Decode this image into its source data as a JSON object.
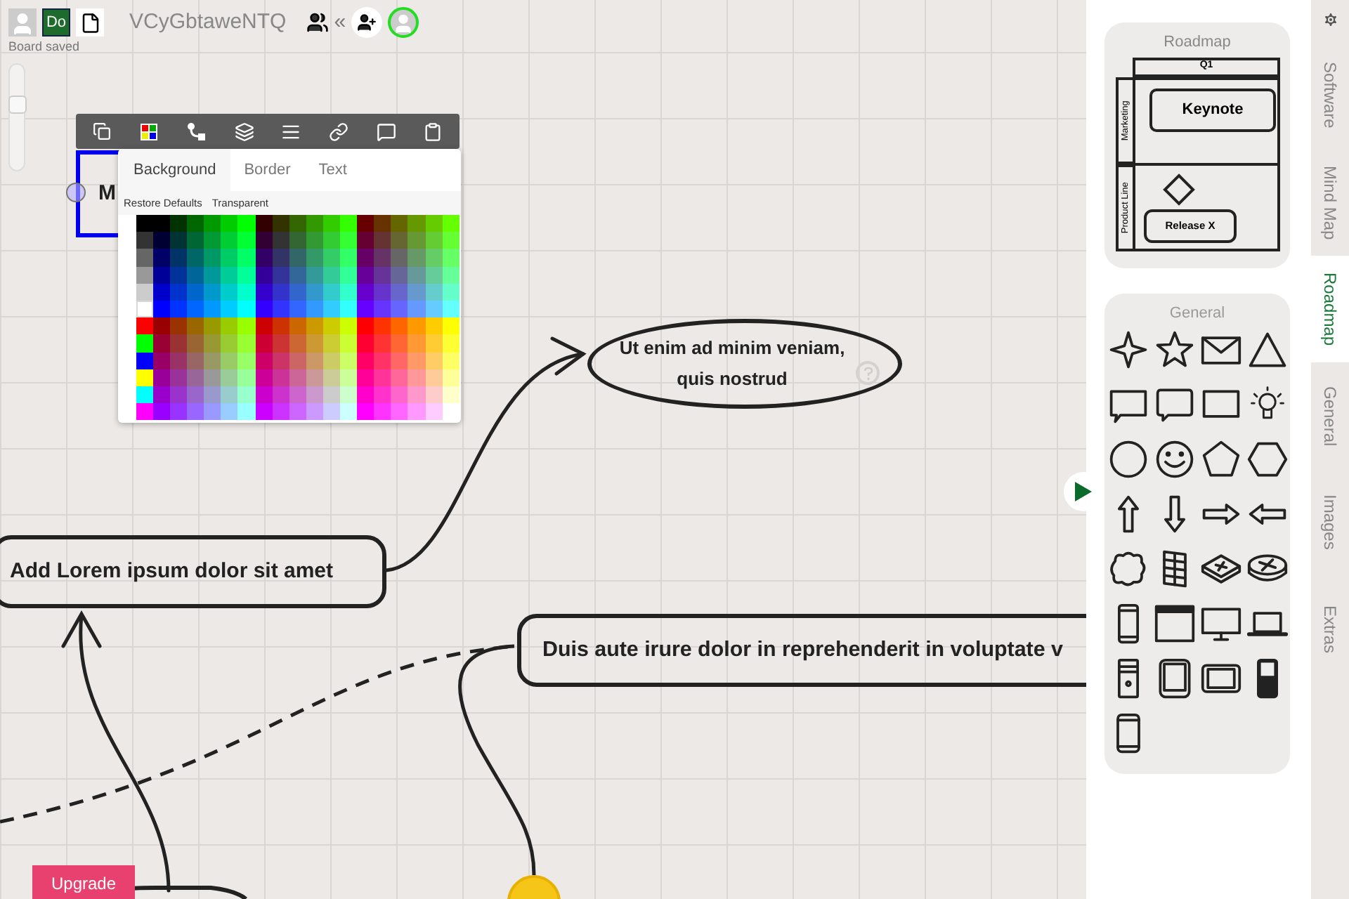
{
  "header": {
    "board_initials": "Do",
    "title": "VCyGbtaweNTQ",
    "collapse_glyph": "«",
    "status": "Board saved"
  },
  "zoom": {
    "level": 0.65
  },
  "color_popover": {
    "tabs": [
      {
        "label": "Background",
        "selected": true
      },
      {
        "label": "Border",
        "selected": false
      },
      {
        "label": "Text",
        "selected": false
      }
    ],
    "actions": [
      "Restore Defaults",
      "Transparent"
    ]
  },
  "selected_node": {
    "text": "M"
  },
  "ellipse_node": {
    "text": "Ut enim ad minim veniam, quis nostrud"
  },
  "lorem_node": {
    "text": "Add Lorem ipsum dolor sit amet"
  },
  "duis_node": {
    "text": "Duis aute irure dolor in reprehenderit in voluptate v"
  },
  "upgrade_button": "Upgrade",
  "roadmap_card": {
    "title": "Roadmap",
    "quarter": "Q1",
    "lanes": [
      "Marketing",
      "Product Line"
    ],
    "items": [
      "Keynote",
      "Release X"
    ]
  },
  "general_card": {
    "title": "General"
  },
  "side_tabs": [
    {
      "label": "Software",
      "selected": false
    },
    {
      "label": "Mind Map",
      "selected": false
    },
    {
      "label": "Roadmap",
      "selected": true
    },
    {
      "label": "General",
      "selected": false
    },
    {
      "label": "Images",
      "selected": false
    },
    {
      "label": "Extras",
      "selected": false
    }
  ]
}
